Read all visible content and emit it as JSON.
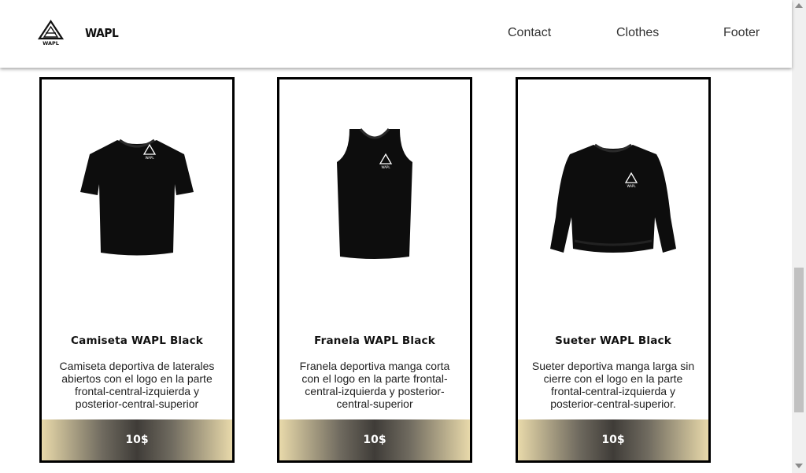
{
  "nav": {
    "brand": "WAPL",
    "logo_icon": "wapl-logo-icon",
    "links": [
      "Contact",
      "Clothes",
      "Footer"
    ]
  },
  "products": [
    {
      "title": "Camiseta WAPL Black",
      "description": "Camiseta deportiva de laterales abiertos con el logo en la parte frontal-central-izquierda y posterior-central-superior",
      "price": "10$",
      "image_icon": "tshirt-icon"
    },
    {
      "title": "Franela WAPL Black",
      "description": "Franela deportiva manga corta con el logo en la parte frontal-central-izquierda y posterior-central-superior",
      "price": "10$",
      "image_icon": "tank-top-icon"
    },
    {
      "title": "Sueter WAPL Black",
      "description": "Sueter deportiva manga larga sin cierre con el logo en la parte frontal-central-izquierda y posterior-central-superior.",
      "price": "10$",
      "image_icon": "sweater-icon"
    }
  ],
  "colors": {
    "card_border": "#000000",
    "price_gradient_edge": "#e8d9aa",
    "price_gradient_center": "#3f3c38"
  }
}
